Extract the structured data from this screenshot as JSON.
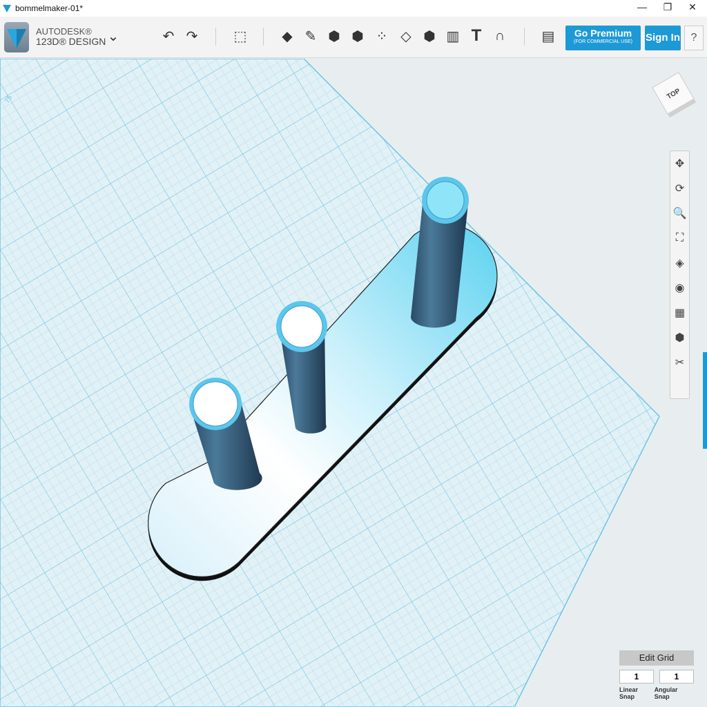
{
  "window": {
    "title": "bommelmaker-01*",
    "minimize": "—",
    "restore": "❐",
    "close": "✕"
  },
  "app": {
    "brand_top": "AUTODESK®",
    "brand_bottom": "123D® DESIGN",
    "menu_chevron": "⌄"
  },
  "toolbar": {
    "undo": "↶",
    "redo": "↷",
    "tools": [
      {
        "name": "transform-icon",
        "glyph": "⬚"
      },
      {
        "name": "primitives-icon",
        "glyph": "◆"
      },
      {
        "name": "sketch-icon",
        "glyph": "✎"
      },
      {
        "name": "construct-icon",
        "glyph": "⬢"
      },
      {
        "name": "modify-icon",
        "glyph": "⬢"
      },
      {
        "name": "pattern-icon",
        "glyph": "⁘"
      },
      {
        "name": "grouping-icon",
        "glyph": "◇"
      },
      {
        "name": "combine-icon",
        "glyph": "⬢"
      },
      {
        "name": "measure-icon",
        "glyph": "▥"
      },
      {
        "name": "text-icon",
        "glyph": "T"
      },
      {
        "name": "snap-icon",
        "glyph": "∩"
      },
      {
        "name": "materials-icon",
        "glyph": "▤"
      }
    ],
    "premium_label": "Go Premium",
    "premium_sub": "(FOR COMMERCIAL USE)",
    "sign_in": "Sign In",
    "help": "?"
  },
  "viewcube": {
    "label": "TOP"
  },
  "grid_label": "75",
  "nav": [
    "✥",
    "⟳",
    "🔍",
    "⛶",
    "◈",
    "◉",
    "▦",
    "⬢",
    "✂"
  ],
  "grid_panel": {
    "edit_grid": "Edit Grid",
    "linear_value": "1",
    "angular_value": "1",
    "linear_label": "Linear Snap",
    "angular_label": "Angular Snap"
  },
  "colors": {
    "accent": "#1d9ad6",
    "grid": "#8fd0ea",
    "plane": "#e2f1f6"
  }
}
